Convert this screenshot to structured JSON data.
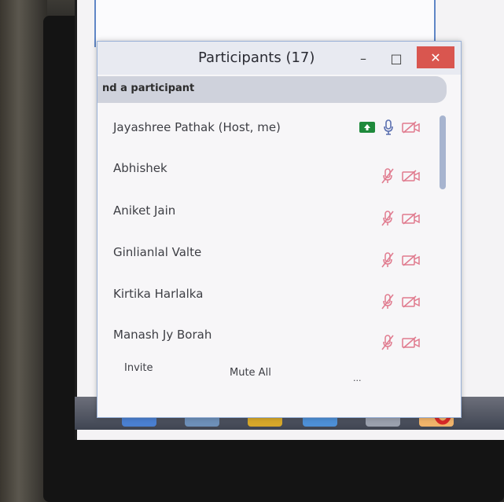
{
  "window": {
    "title": "Participants (17)",
    "minimize_label": "–",
    "maximize_label": "□",
    "close_label": "✕"
  },
  "search": {
    "placeholder": "nd a participant"
  },
  "participants": [
    {
      "name": "Jayashree Pathak (Host, me)",
      "sharing_icon": "share-screen-icon",
      "mic": "on",
      "video": "off"
    },
    {
      "name": "Abhishek",
      "mic": "muted",
      "video": "off"
    },
    {
      "name": "Aniket Jain",
      "mic": "muted",
      "video": "off"
    },
    {
      "name": "Ginlianlal Valte",
      "mic": "muted",
      "video": "off"
    },
    {
      "name": "Kirtika Harlalka",
      "mic": "muted",
      "video": "off"
    },
    {
      "name": "Manash Jy Borah",
      "mic": "muted",
      "video": "off"
    }
  ],
  "footer": {
    "invite_label": "Invite",
    "mute_all_label": "Mute All",
    "more_label": "..."
  },
  "colors": {
    "muted_icon": "#e07a8e",
    "share_icon_bg": "#1f8a3c",
    "mic_on": "#5a6fb0",
    "close_button": "#d9564f"
  }
}
